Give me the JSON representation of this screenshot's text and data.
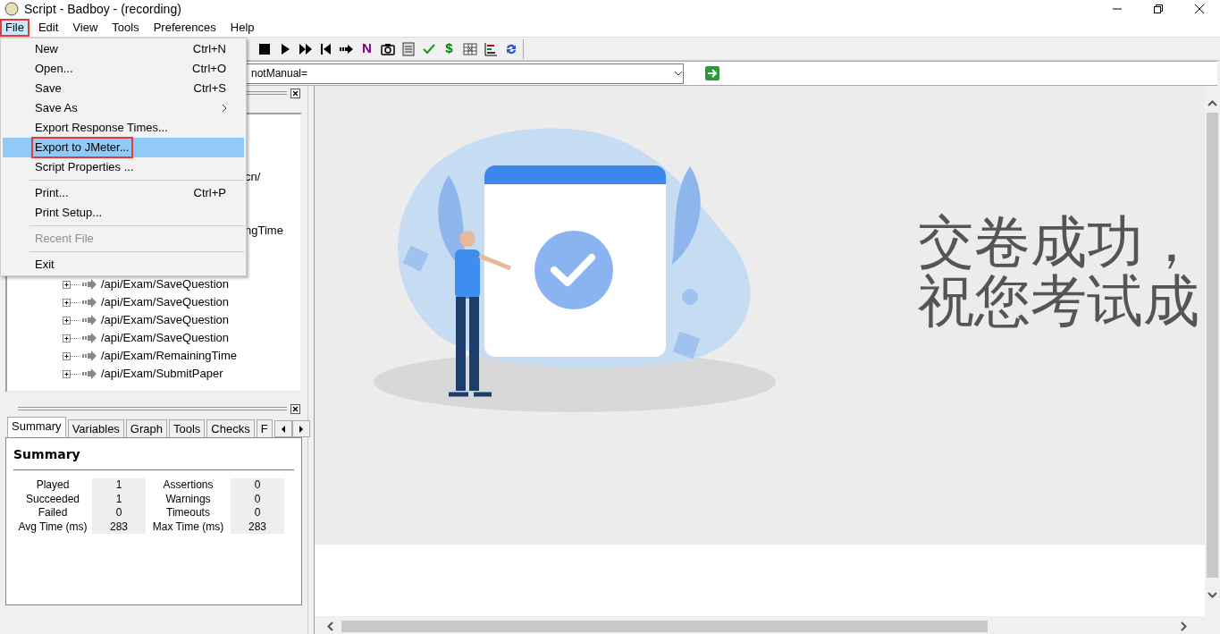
{
  "window": {
    "title": "Script - Badboy - (recording)"
  },
  "menubar": [
    {
      "label": "File",
      "selected": true,
      "annotated": true
    },
    {
      "label": "Edit",
      "selected": false,
      "annotated": false
    },
    {
      "label": "View",
      "selected": false,
      "annotated": false
    },
    {
      "label": "Tools",
      "selected": false,
      "annotated": false
    },
    {
      "label": "Preferences",
      "selected": false,
      "annotated": false
    },
    {
      "label": "Help",
      "selected": false,
      "annotated": false
    }
  ],
  "file_menu": [
    {
      "kind": "item",
      "label": "New",
      "shortcut": "Ctrl+N",
      "selected": false,
      "disabled": false,
      "annotated": false
    },
    {
      "kind": "item",
      "label": "Open...",
      "shortcut": "Ctrl+O",
      "selected": false,
      "disabled": false,
      "annotated": false
    },
    {
      "kind": "item",
      "label": "Save",
      "shortcut": "Ctrl+S",
      "selected": false,
      "disabled": false,
      "annotated": false
    },
    {
      "kind": "submenu",
      "label": "Save As",
      "selected": false,
      "disabled": false,
      "annotated": false
    },
    {
      "kind": "item",
      "label": "Export Response Times...",
      "selected": false,
      "disabled": false,
      "annotated": false
    },
    {
      "kind": "item",
      "label": "Export to JMeter...",
      "selected": true,
      "disabled": false,
      "annotated": true
    },
    {
      "kind": "item",
      "label": "Script Properties ...",
      "selected": false,
      "disabled": false,
      "annotated": false
    },
    {
      "kind": "separator"
    },
    {
      "kind": "item",
      "label": "Print...",
      "shortcut": "Ctrl+P",
      "selected": false,
      "disabled": false,
      "annotated": false
    },
    {
      "kind": "item",
      "label": "Print Setup...",
      "selected": false,
      "disabled": false,
      "annotated": false
    },
    {
      "kind": "separator"
    },
    {
      "kind": "item",
      "label": "Recent File",
      "selected": false,
      "disabled": true,
      "annotated": false
    },
    {
      "kind": "separator"
    },
    {
      "kind": "item",
      "label": "Exit",
      "selected": false,
      "disabled": false,
      "annotated": false
    }
  ],
  "toolbar": [
    {
      "kind": "stop"
    },
    {
      "kind": "play"
    },
    {
      "kind": "fast_forward"
    },
    {
      "kind": "step_back"
    },
    {
      "kind": "advance"
    },
    {
      "kind": "glyph",
      "text": "N",
      "color": "#800080"
    },
    {
      "kind": "camera"
    },
    {
      "kind": "page"
    },
    {
      "kind": "check"
    },
    {
      "kind": "glyph",
      "text": "$",
      "color": "#008000"
    },
    {
      "kind": "table"
    },
    {
      "kind": "chart"
    },
    {
      "kind": "refresh"
    }
  ],
  "address_bar": {
    "value": "notManual="
  },
  "tree": {
    "items": [
      {
        "kind": "clipped",
        "label": "cn/"
      },
      {
        "kind": "clipped",
        "label": "ngTime"
      },
      {
        "kind": "request",
        "label": "/api/Exam/SaveQuestion"
      },
      {
        "kind": "request",
        "label": "/api/Exam/SaveQuestion"
      },
      {
        "kind": "request",
        "label": "/api/Exam/SaveQuestion"
      },
      {
        "kind": "request",
        "label": "/api/Exam/SaveQuestion"
      },
      {
        "kind": "request",
        "label": "/api/Exam/RemainingTime"
      },
      {
        "kind": "request",
        "label": "/api/Exam/SubmitPaper"
      }
    ]
  },
  "bottom_panel": {
    "tabs": [
      {
        "label": "Summary",
        "selected": true
      },
      {
        "label": "Variables",
        "selected": false
      },
      {
        "label": "Graph",
        "selected": false
      },
      {
        "label": "Tools",
        "selected": false
      },
      {
        "label": "Checks",
        "selected": false
      },
      {
        "label": "F",
        "selected": false
      }
    ],
    "summary": {
      "title": "Summary",
      "stats": [
        {
          "label": "Played",
          "value": "1"
        },
        {
          "label": "Assertions",
          "value": "0"
        },
        {
          "label": "Succeeded",
          "value": "1"
        },
        {
          "label": "Warnings",
          "value": "0"
        },
        {
          "label": "Failed",
          "value": "0"
        },
        {
          "label": "Timeouts",
          "value": "0"
        },
        {
          "label": "Avg Time (ms)",
          "value": "283"
        },
        {
          "label": "Max Time (ms)",
          "value": "283"
        }
      ]
    }
  },
  "browser": {
    "message": [
      "交卷成功，",
      "祝您考试成"
    ]
  }
}
